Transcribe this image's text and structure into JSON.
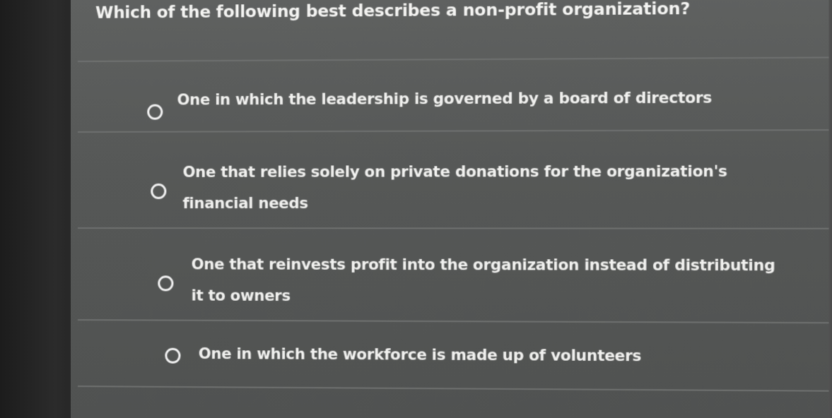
{
  "question": {
    "text": "Which of the following best describes a non-profit organization?"
  },
  "options": [
    {
      "label": "One in which the leadership is governed by a board of directors",
      "selected": false
    },
    {
      "label": "One that relies solely on private donations for the organization's financial needs",
      "selected": false
    },
    {
      "label": "One that reinvests profit into the organization instead of distributing it to owners",
      "selected": false
    },
    {
      "label": "One in which the workforce is made up of volunteers",
      "selected": false
    }
  ],
  "colors": {
    "background": "#575958",
    "text": "#f1f1ef",
    "divider": "#6e706f"
  }
}
